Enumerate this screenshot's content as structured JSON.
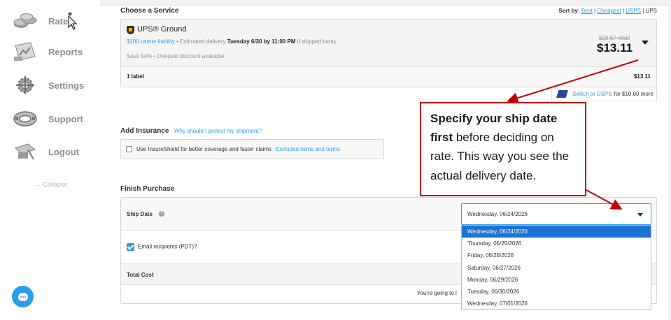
{
  "sidebar": {
    "items": [
      {
        "label": "Rates",
        "icon": "coins-icon"
      },
      {
        "label": "Reports",
        "icon": "reports-icon"
      },
      {
        "label": "Settings",
        "icon": "gear-icon"
      },
      {
        "label": "Support",
        "icon": "lifebuoy-icon"
      },
      {
        "label": "Logout",
        "icon": "logout-icon"
      }
    ],
    "collapse": "← Collapse"
  },
  "service": {
    "section_title": "Choose a Service",
    "sort_by_label": "Sort by:",
    "sort_options": [
      "Best",
      "Cheapest",
      "USPS",
      "UPS"
    ],
    "sort_separators": [
      "|",
      "|",
      "|"
    ],
    "name": "UPS® Ground",
    "liability": "$100 carrier liability",
    "estimated_prefix": "• Estimated delivery",
    "delivery": "Tuesday 6/30 by 11:00 PM",
    "delivery_suffix": "if shipped today",
    "savings": "Save 54% • Deepest discount available",
    "retail": "$28.67 retail",
    "price": "$13.11",
    "label_count": "1 label",
    "label_total": "$13.11",
    "switch_link": "Switch to USPS",
    "switch_suffix": "for $10.60 more"
  },
  "insurance": {
    "title": "Add Insurance",
    "help_link": "Why should I protect my shipment?",
    "checkbox_label": "Use InsureShield for better coverage and faster claims",
    "excluded_link": "Excluded items and terms"
  },
  "finish": {
    "title": "Finish Purchase",
    "ship_date_label": "Ship Date",
    "help_glyph": "?",
    "email_label": "Email recipients (PDT)?",
    "total_cost_label": "Total Cost",
    "going_to_text": "You're going to l",
    "selected_date": "Wednesday, 06/24/2026",
    "date_options": [
      "Wednesday, 06/24/2026",
      "Thursday, 06/25/2026",
      "Friday, 06/26/2026",
      "Saturday, 06/27/2026",
      "Monday, 06/29/2026",
      "Tuesday, 06/30/2026",
      "Wednesday, 07/01/2026"
    ]
  },
  "callout": {
    "bold_text": "Specify your ship date first",
    "rest_text": " before deciding on rate. This way you see the actual delivery date."
  },
  "colors": {
    "accent": "#2b9de6",
    "selected_option": "#1e73d2",
    "annotation": "#c00000"
  }
}
